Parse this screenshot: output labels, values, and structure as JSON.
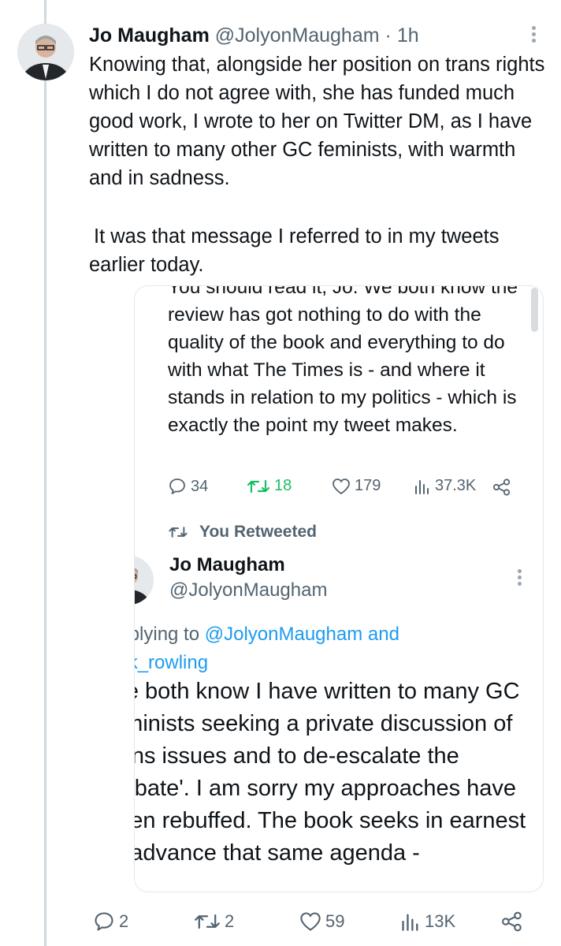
{
  "tweet": {
    "author_name": "Jo Maugham",
    "handle": "@JolyonMaugham",
    "separator": "·",
    "time": "1h",
    "paragraph1": "Knowing that, alongside her position on trans rights which I do not agree with, she has funded much good work, I wrote to her on Twitter DM, as I have written to many other GC feminists, with warmth and in sadness.",
    "paragraph2": "It was that message I referred to in my tweets earlier today.",
    "actions": {
      "replies": "2",
      "retweets": "2",
      "likes": "59",
      "views": "13K"
    }
  },
  "quoted_tweet": {
    "cut_text": "You should read it, Jo. We both know the review has got nothing to do with the quality of the book and everything to do with what The Times is - and where it stands in relation to my politics - which is exactly the point my tweet makes.",
    "actions": {
      "replies": "34",
      "retweets": "18",
      "likes": "179",
      "views": "37.3K"
    },
    "retweet_label": "You Retweeted",
    "inner": {
      "author_name": "Jo Maugham",
      "handle": "@JolyonMaugham",
      "replying_prefix": "Replying to",
      "replying_to_1": "@JolyonMaugham",
      "replying_and": "and",
      "replying_to_2": "@jk_rowling",
      "text": "We both know I have written to many GC feminists seeking a private discussion of trans issues and to de-escalate the 'debate'. I am sorry my approaches have been rebuffed. The book seeks in earnest to advance that same agenda -"
    }
  },
  "icons": {
    "reply": "reply-icon",
    "retweet": "retweet-icon",
    "like": "heart-icon",
    "views": "views-icon",
    "share": "share-icon",
    "more": "more-vertical-icon"
  },
  "colors": {
    "text": "#0f1419",
    "muted": "#536471",
    "retweet_active": "#17bf63",
    "link": "#1d9bf0",
    "thread_line": "#cfd9de"
  }
}
